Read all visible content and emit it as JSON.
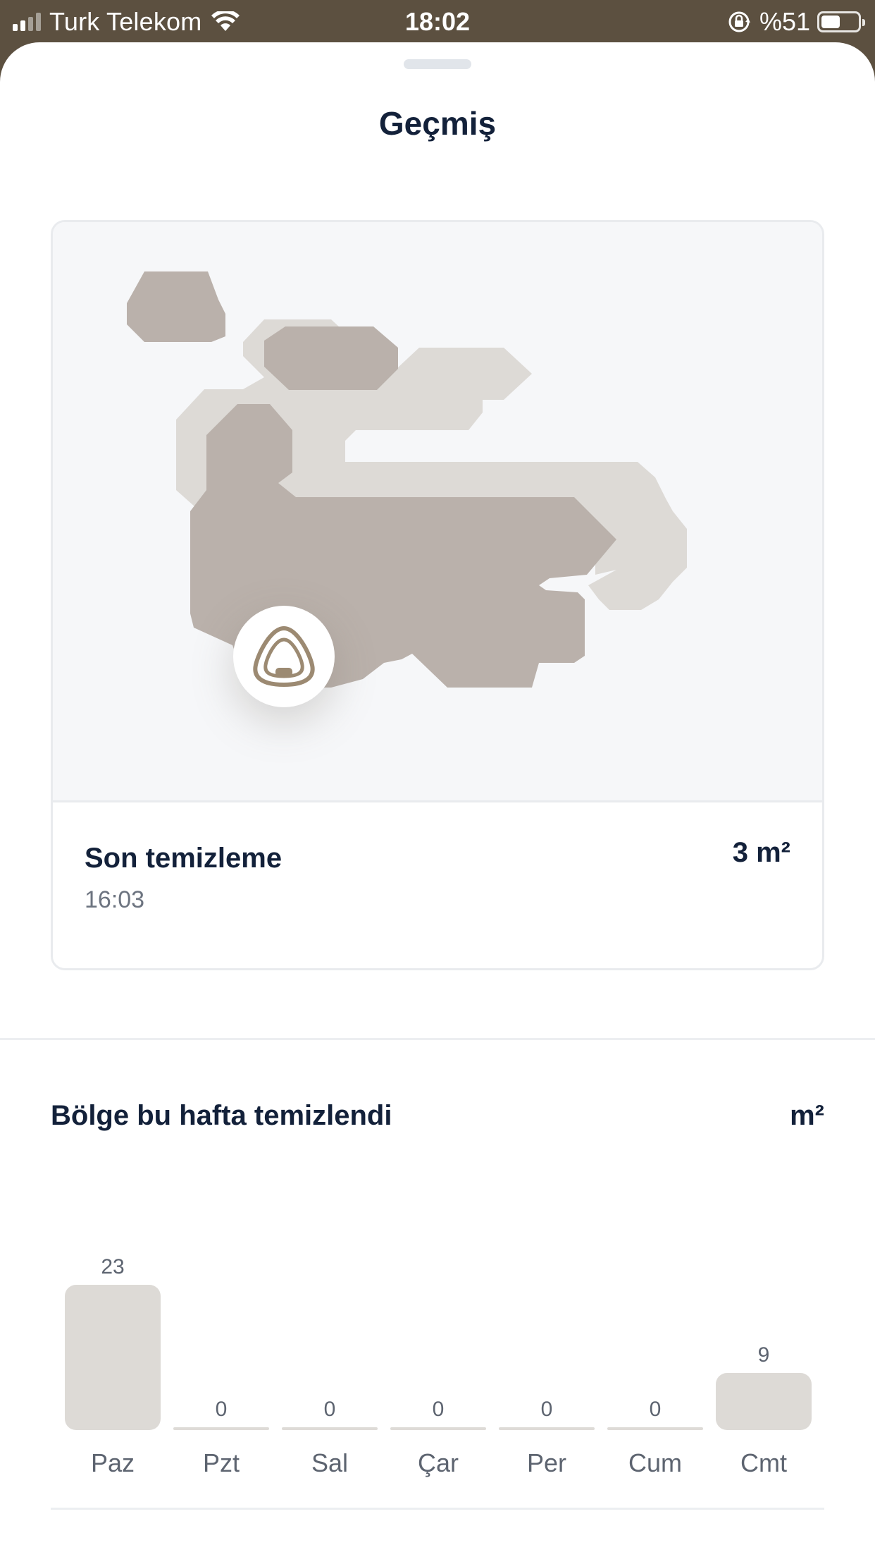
{
  "status_bar": {
    "carrier": "Turk Telekom",
    "time": "18:02",
    "battery_percent": "%51",
    "battery_level": 0.51,
    "signal_bars": 2,
    "icons": [
      "signal-icon",
      "wifi-icon",
      "rotation-lock-icon",
      "battery-icon"
    ]
  },
  "sheet": {
    "title": "Geçmiş"
  },
  "last_clean": {
    "label": "Son temizleme",
    "time": "16:03",
    "area": "3 m²",
    "dock_icon": "robot-dock-icon"
  },
  "weekly": {
    "title": "Bölge bu hafta temizlendi",
    "unit": "m²"
  },
  "chart_data": {
    "type": "bar",
    "categories": [
      "Paz",
      "Pzt",
      "Sal",
      "Çar",
      "Per",
      "Cum",
      "Cmt"
    ],
    "values": [
      23,
      0,
      0,
      0,
      0,
      0,
      9
    ],
    "ylim": [
      0,
      23
    ],
    "grid": false
  },
  "colors": {
    "status_bar_bg": "#5c5040",
    "text_primary": "#13213a",
    "bar_fill": "#dddad6",
    "map_clean_dark": "#bab1ab",
    "map_clean_light": "#dddad6",
    "dock_accent": "#9c8a72"
  }
}
